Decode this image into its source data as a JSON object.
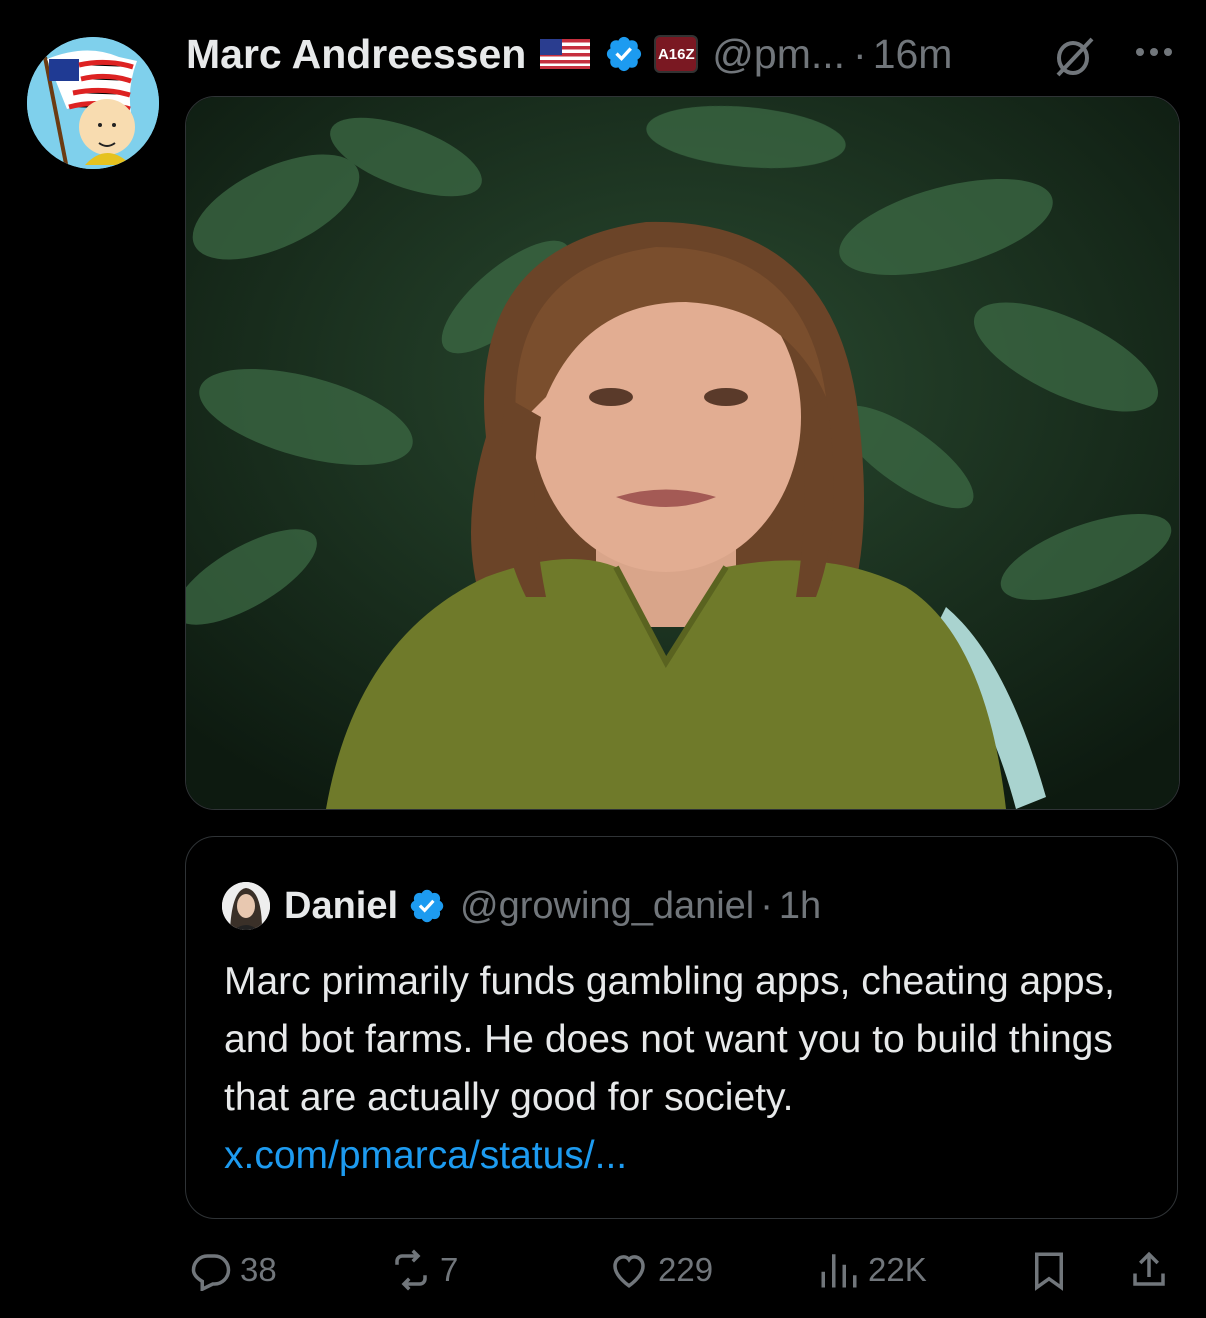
{
  "tweet": {
    "author_name": "Marc Andreessen",
    "flag_emoji": "us-flag",
    "verified": true,
    "affiliation_badge": "A16Z",
    "handle": "@pm...",
    "separator": "·",
    "time": "16m",
    "media_alt": "video still"
  },
  "quoted_tweet": {
    "author_name": "Daniel",
    "verified": true,
    "handle": "@growing_daniel",
    "separator": "·",
    "time": "1h",
    "text": "Marc primarily funds gambling apps, cheating apps, and bot farms. He does not want you to build things that are actually good for society. ",
    "link": "x.com/pmarca/status/..."
  },
  "actions": {
    "replies": "38",
    "reposts": "7",
    "likes": "229",
    "views": "22K"
  },
  "colors": {
    "background": "#000000",
    "primary_text": "#e7e9ea",
    "secondary_text": "#71767b",
    "link": "#1d9bf0",
    "verified": "#1d9bf0",
    "border": "#2f3336"
  }
}
